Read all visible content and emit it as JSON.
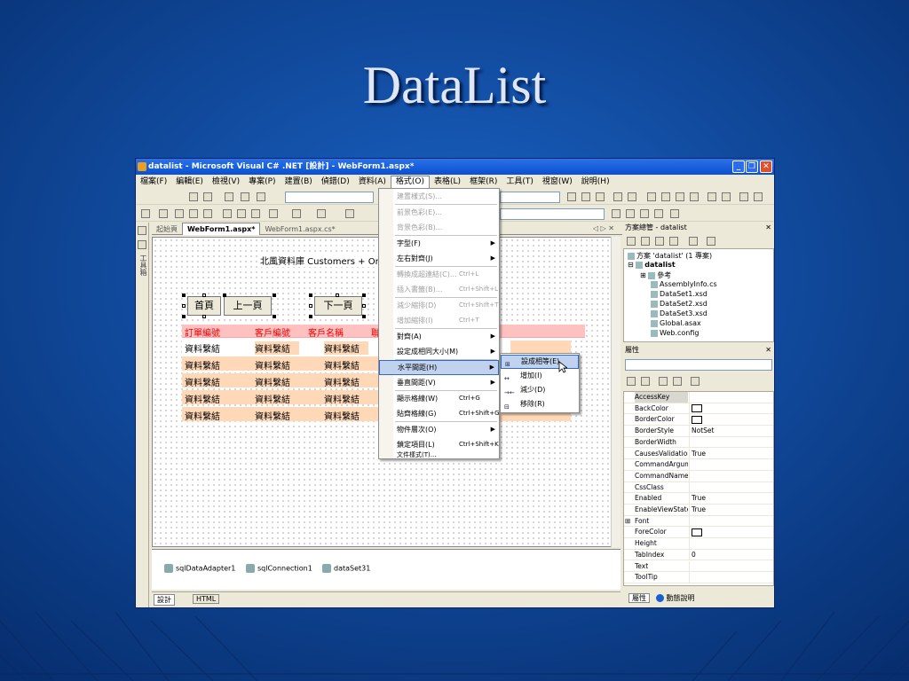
{
  "slide": {
    "title": "DataList"
  },
  "window": {
    "title": "datalist - Microsoft Visual C# .NET [設計] - WebForm1.aspx*",
    "controls": {
      "minimize": "_",
      "restore": "❐",
      "close": "✕"
    }
  },
  "menubar": [
    {
      "label": "檔案(F)"
    },
    {
      "label": "編輯(E)"
    },
    {
      "label": "檢視(V)"
    },
    {
      "label": "專案(P)"
    },
    {
      "label": "建置(B)"
    },
    {
      "label": "偵錯(D)"
    },
    {
      "label": "資料(A)"
    },
    {
      "label": "格式(O)"
    },
    {
      "label": "表格(L)"
    },
    {
      "label": "框架(R)"
    },
    {
      "label": "工具(T)"
    },
    {
      "label": "視窗(W)"
    },
    {
      "label": "說明(H)"
    }
  ],
  "toolbox": {
    "label": "工具箱"
  },
  "tabs": [
    {
      "label": "起始頁"
    },
    {
      "label": "WebForm1.aspx*"
    },
    {
      "label": "WebForm1.aspx.cs*"
    }
  ],
  "tab_controls": "◁ ▷ ✕",
  "design": {
    "heading": "北風資料庫 Customers + Orders",
    "buttons": {
      "first": "首頁",
      "prev": "上一頁",
      "next": "下一頁"
    },
    "header": [
      "訂單編號",
      "客戶編號",
      "客戶名稱",
      "聯"
    ],
    "cell": "資料繫結"
  },
  "format_menu": {
    "items": [
      {
        "label": "建置樣式(S)...",
        "shortcut": ""
      },
      {
        "label": "前景色彩(E)...",
        "shortcut": ""
      },
      {
        "label": "背景色彩(B)...",
        "shortcut": ""
      },
      {
        "label": "字型(F)",
        "shortcut": ""
      },
      {
        "label": "左右對齊(J)",
        "shortcut": ""
      },
      {
        "label": "轉換成超連結(C)...",
        "shortcut": "Ctrl+L"
      },
      {
        "label": "插入書籤(B)...",
        "shortcut": "Ctrl+Shift+L"
      },
      {
        "label": "減少縮排(D)",
        "shortcut": "Ctrl+Shift+T"
      },
      {
        "label": "增加縮排(I)",
        "shortcut": "Ctrl+T"
      },
      {
        "label": "對齊(A)",
        "shortcut": ""
      },
      {
        "label": "設定成相同大小(M)",
        "shortcut": ""
      },
      {
        "label": "水平間距(H)",
        "shortcut": ""
      },
      {
        "label": "垂直間距(V)",
        "shortcut": ""
      },
      {
        "label": "顯示格線(W)",
        "shortcut": "Ctrl+G"
      },
      {
        "label": "貼齊格線(G)",
        "shortcut": "Ctrl+Shift+G"
      },
      {
        "label": "物件層次(O)",
        "shortcut": ""
      },
      {
        "label": "鎖定項目(L)",
        "shortcut": "Ctrl+Shift+K"
      },
      {
        "label": "文件樣式(T)...",
        "shortcut": ""
      }
    ]
  },
  "spacing_submenu": {
    "items": [
      {
        "label": "設成相等(E)",
        "icon": "⊞"
      },
      {
        "label": "增加(I)",
        "icon": "↔"
      },
      {
        "label": "減少(D)",
        "icon": "→←"
      },
      {
        "label": "移除(R)",
        "icon": "⊟"
      }
    ]
  },
  "component_tray": [
    {
      "label": "sqlDataAdapter1"
    },
    {
      "label": "sqlConnection1"
    },
    {
      "label": "dataSet31"
    }
  ],
  "view_tabs": {
    "design": "設計",
    "html": "HTML"
  },
  "solution_explorer": {
    "title": "方案總管 - datalist",
    "nodes": [
      {
        "label": "方案 'datalist' (1 專案)"
      },
      {
        "label": "datalist"
      },
      {
        "label": "參考"
      },
      {
        "label": "AssemblyInfo.cs"
      },
      {
        "label": "DataSet1.xsd"
      },
      {
        "label": "DataSet2.xsd"
      },
      {
        "label": "DataSet3.xsd"
      },
      {
        "label": "Global.asax"
      },
      {
        "label": "Web.config"
      }
    ]
  },
  "properties": {
    "title": "屬性",
    "rows": [
      {
        "name": "AccessKey",
        "value": ""
      },
      {
        "name": "BackColor",
        "value": ""
      },
      {
        "name": "BorderColor",
        "value": ""
      },
      {
        "name": "BorderStyle",
        "value": "NotSet"
      },
      {
        "name": "BorderWidth",
        "value": ""
      },
      {
        "name": "CausesValidation",
        "value": "True"
      },
      {
        "name": "CommandArgum",
        "value": ""
      },
      {
        "name": "CommandName",
        "value": ""
      },
      {
        "name": "CssClass",
        "value": ""
      },
      {
        "name": "Enabled",
        "value": "True"
      },
      {
        "name": "EnableViewState",
        "value": "True"
      },
      {
        "name": "Font",
        "value": ""
      },
      {
        "name": "ForeColor",
        "value": ""
      },
      {
        "name": "Height",
        "value": ""
      },
      {
        "name": "TabIndex",
        "value": "0"
      },
      {
        "name": "Text",
        "value": ""
      },
      {
        "name": "ToolTip",
        "value": ""
      }
    ],
    "bottom_tabs": {
      "props": "屬性",
      "help": "動態說明"
    }
  },
  "colors": {
    "titlebar": "#0a4fd0",
    "header_text": "#e00000",
    "header_bg": "#ffc0c0",
    "row_bg": "#ffd8b8",
    "highlight": "#c1d2ee"
  }
}
